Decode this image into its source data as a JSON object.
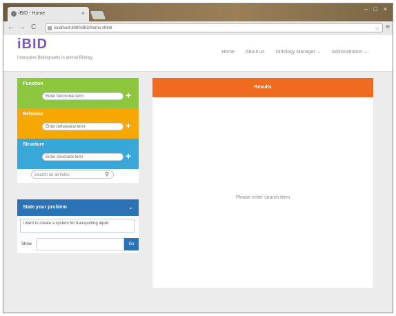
{
  "browser": {
    "tab_title": "iBID - Home",
    "tab_close": "×",
    "window_min": "–",
    "window_max": "□",
    "window_close": "×",
    "back": "←",
    "forward": "→",
    "reload": "C",
    "address": "localhost:8080/iBID/home.xhtml",
    "menu": "≡"
  },
  "app": {
    "logo": "iBID",
    "tagline": "Interactive Bibliography in animal Biology",
    "nav": [
      "Home",
      "About us",
      "Ontology Manager ⌄",
      "Administration ⌄"
    ]
  },
  "sections": [
    {
      "title": "Function",
      "placeholder": "Enter functional term",
      "color": "#8dc63f"
    },
    {
      "title": "Behavior",
      "placeholder": "Enter behavioral term",
      "color": "#f6a800"
    },
    {
      "title": "Structure",
      "placeholder": "Enter structural term",
      "color": "#3aa7d9"
    }
  ],
  "search": {
    "placeholder": "Search on all fields"
  },
  "problem": {
    "title": "State your problem",
    "text": "I want to create a system for transporting liquid",
    "label": "Show",
    "go_label": "Go"
  },
  "results": {
    "title": "Results",
    "message": "Please enter search term"
  },
  "colors": {
    "accent": "#7a59b2",
    "problem": "#2c72b5",
    "results": "#f16a22"
  }
}
